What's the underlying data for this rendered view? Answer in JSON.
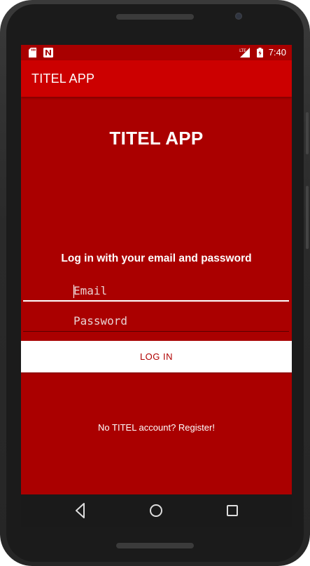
{
  "status_bar": {
    "time": "7:40",
    "icons": [
      "sd-card-icon",
      "notification-n-icon",
      "signal-lte-icon",
      "battery-icon"
    ],
    "network_label": "LTE"
  },
  "app_bar": {
    "title": "TITEL APP"
  },
  "login": {
    "heading": "TITEL APP",
    "instruction": "Log in with your email and password",
    "email_placeholder": "Email",
    "password_placeholder": "Password",
    "login_button": "LOG IN",
    "register_link": "No TITEL account? Register!"
  },
  "nav_bar": {
    "buttons": [
      "back-icon",
      "home-icon",
      "recents-icon"
    ]
  },
  "colors": {
    "background": "#aa0000",
    "app_bar": "#cc0000",
    "status_bar": "#a80000",
    "button_bg": "#ffffff",
    "button_text": "#b00000"
  }
}
